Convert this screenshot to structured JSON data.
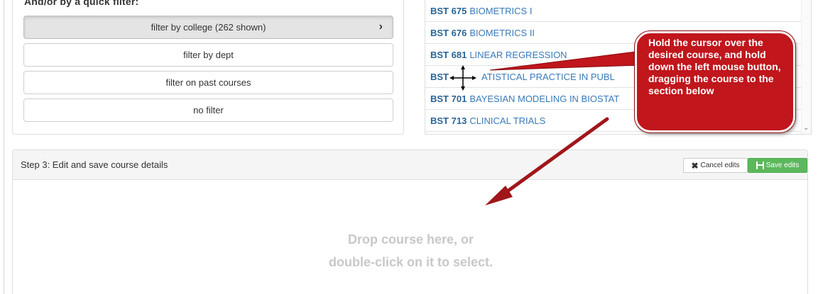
{
  "filters": {
    "title": "And/or by a quick filter:",
    "buttons": [
      {
        "label": "filter by college (262 shown)",
        "active": true
      },
      {
        "label": "filter by dept",
        "active": false
      },
      {
        "label": "filter on past courses",
        "active": false
      },
      {
        "label": "no filter",
        "active": false
      }
    ],
    "active_chevron": "›"
  },
  "courses": [
    {
      "code": "BST 675",
      "name": "BIOMETRICS I"
    },
    {
      "code": "BST 676",
      "name": "BIOMETRICS II"
    },
    {
      "code": "BST 681",
      "name": "LINEAR REGRESSION"
    },
    {
      "code": "BST",
      "name": "ATISTICAL PRACTICE IN PUBL"
    },
    {
      "code": "BST 701",
      "name": "BAYESIAN MODELING IN BIOSTAT"
    },
    {
      "code": "BST 713",
      "name": "CLINICAL TRIALS"
    }
  ],
  "step3": {
    "title": "Step 3: Edit and save course details",
    "cancel_label": "Cancel edits",
    "save_label": "Save edits",
    "drop_line1": "Drop course here, or",
    "drop_line2": "double-click on it to select."
  },
  "callout": {
    "text": "Hold the cursor over the desired course, and hold down the left mouse button, dragging the course to the section below"
  },
  "colors": {
    "callout_red": "#c0161c",
    "link_blue": "#3a7ab8",
    "save_green": "#5cb85c"
  },
  "icons": {
    "chevron": "chevron-right-icon",
    "cancel": "x-icon",
    "save": "floppy-disk-icon",
    "cursor": "move-cursor-icon"
  }
}
